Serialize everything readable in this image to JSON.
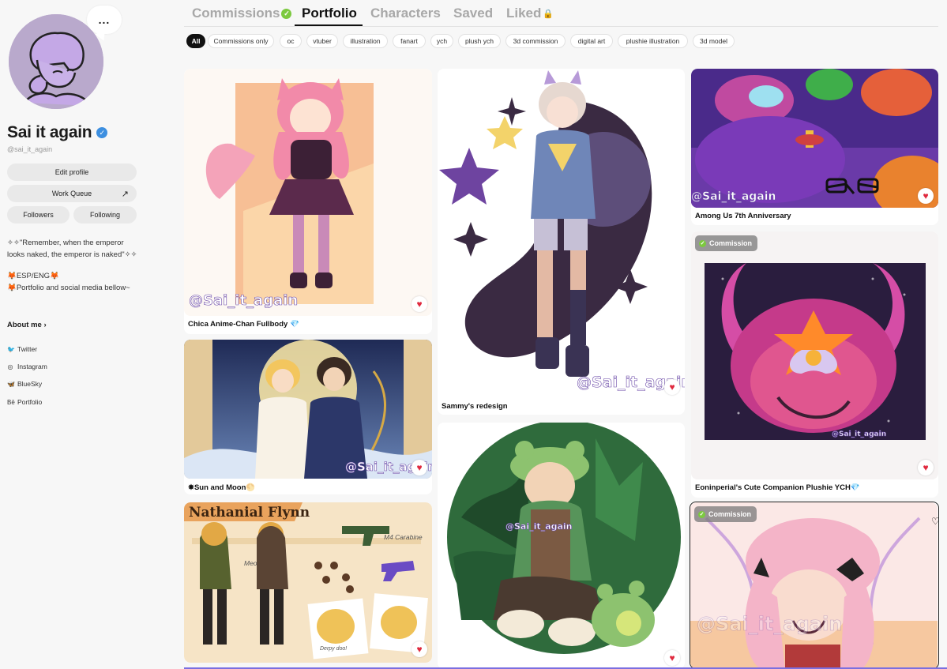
{
  "profile": {
    "more_label": "...",
    "display_name": "Sai it again",
    "handle": "@sai_it_again",
    "verify_glyph": "✓",
    "edit_profile": "Edit profile",
    "work_queue": "Work Queue",
    "work_queue_arrow": "↗",
    "followers": "Followers",
    "following": "Following",
    "bio_quote": "✧✧\"Remember, when the emperor looks naked, the emperor is naked\"✧✧",
    "bio_lang": "🦊ESP/ENG🦊",
    "bio_links": "🦊Portfolio and social media bellow~",
    "about_me": "About me ›",
    "socials": [
      {
        "label": "Twitter",
        "icon": "bird-icon",
        "glyph": "🐦"
      },
      {
        "label": "Instagram",
        "icon": "instagram-icon",
        "glyph": "◎"
      },
      {
        "label": "BlueSky",
        "icon": "butterfly-icon",
        "glyph": "🦋"
      },
      {
        "label": "Portfolio",
        "icon": "behance-icon",
        "glyph": "Bē"
      }
    ]
  },
  "tabs": [
    {
      "label": "Commissions",
      "badge": "✓"
    },
    {
      "label": "Portfolio"
    },
    {
      "label": "Characters"
    },
    {
      "label": "Saved"
    },
    {
      "label": "Liked",
      "lock": "🔒"
    }
  ],
  "filters": [
    "All",
    "Commissions only",
    "oc",
    "vtuber",
    "illustration",
    "fanart",
    "ych",
    "plush ych",
    "3d commission",
    "digital art",
    "plushie illustration",
    "3d model"
  ],
  "cards": [
    {
      "title": "Chica Anime-Chan Fullbody 💎",
      "watermark": "@Sai_it_again"
    },
    {
      "title": "✸Sun and Moon🌕",
      "watermark": "@Sai_it_again"
    },
    {
      "title": "",
      "art_text": "Nathanial Flynn",
      "art_note": "M4 Carabine",
      "art_meow": "Meo",
      "art_caption": "Derpy doo!"
    },
    {
      "title": "Sammy's redesign",
      "watermark": "@Sai_it_again"
    },
    {
      "title": "",
      "watermark": "@Sai_it_again"
    },
    {
      "title": "Among Us 7th Anniversary",
      "watermark": "@Sai_it_again"
    },
    {
      "title": "Eoninperial's Cute Companion Plushie YCH💎",
      "badge": "Commission",
      "watermark": "@Sai_it_again"
    },
    {
      "title": "",
      "badge": "Commission",
      "watermark": "@Sai_it_again"
    }
  ],
  "heart_glyph": "♥",
  "badge_glyph": "✓",
  "colors": {
    "accent": "#111111",
    "heart": "#e0293e",
    "verified": "#3d8fe0",
    "commission_check": "#7cc93f"
  }
}
